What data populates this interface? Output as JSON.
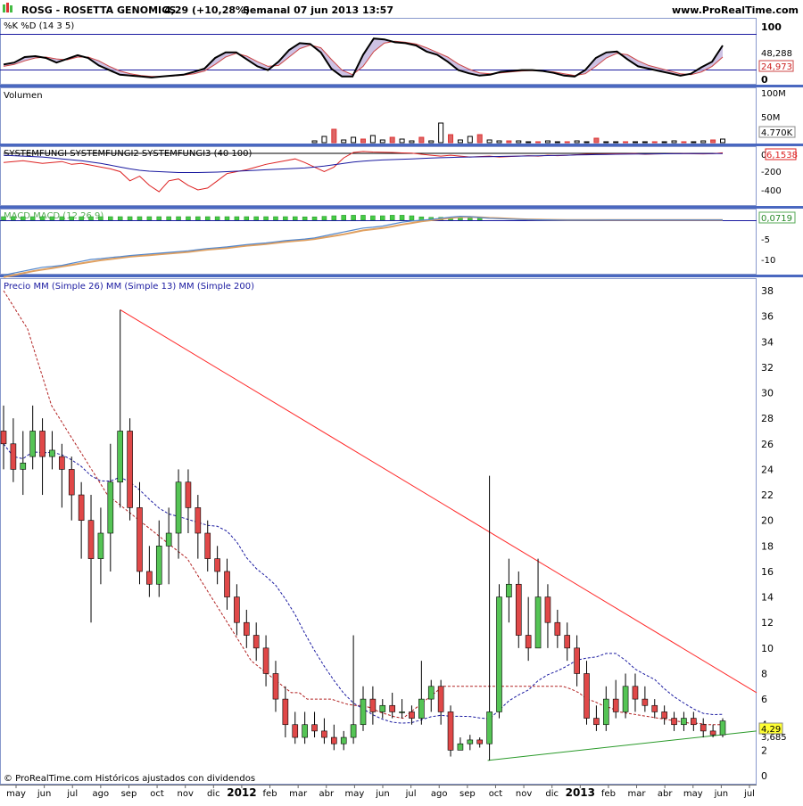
{
  "header": {
    "symbol_title": "ROSG - ROSETTA GENOMICS",
    "quote": "4,29 (+10,28%)",
    "period_date": "Semanal  07 jun 2013 13:57",
    "site": "www.ProRealTime.com"
  },
  "footer": {
    "copyright": "© ProRealTime.com  Históricos ajustados con dividendos"
  },
  "x_axis": {
    "labels": [
      "may",
      "jun",
      "jul",
      "ago",
      "sep",
      "oct",
      "nov",
      "dic",
      "2012",
      "feb",
      "mar",
      "abr",
      "may",
      "jun",
      "jul",
      "ago",
      "sep",
      "oct",
      "nov",
      "dic",
      "2013",
      "feb",
      "mar",
      "abr",
      "may",
      "jun",
      "jul"
    ],
    "bold_labels": [
      "2012",
      "2013"
    ]
  },
  "colors": {
    "up_candle": "#55c455",
    "down_candle": "#e04848",
    "ma26": "#b22222",
    "ma13": "#1a1aa0",
    "resistance_line": "#ff2a2a",
    "support_line": "#2a9a2a",
    "panel_sep": "#4a68c0",
    "stoch_k": "#000000",
    "stoch_d": "#cc4444",
    "vol_up": "#000000",
    "vol_down": "#dd3333",
    "sys1": "#000000",
    "sys2": "#dd2222",
    "sys3": "#1a1aa0",
    "macd_hist": "#44cc44",
    "macd_line": "#5588cc",
    "macd_signal": "#e0a060",
    "last_price_box": "#ffff33"
  },
  "chart_data": [
    {
      "type": "line",
      "panel": "stochastic",
      "title": "%K %D (14 3 5)",
      "ylim": [
        0,
        100
      ],
      "tick_labels": [
        "100",
        "0"
      ],
      "value_labels": [
        "48,288",
        "24,973"
      ],
      "series": [
        {
          "name": "%K",
          "values": [
            34,
            38,
            50,
            52,
            48,
            38,
            46,
            54,
            48,
            32,
            22,
            12,
            10,
            8,
            6,
            8,
            10,
            12,
            18,
            25,
            48,
            60,
            60,
            45,
            30,
            22,
            40,
            65,
            80,
            78,
            60,
            25,
            8,
            8,
            55,
            90,
            88,
            82,
            80,
            75,
            62,
            55,
            40,
            22,
            15,
            10,
            12,
            18,
            20,
            22,
            22,
            20,
            16,
            10,
            8,
            22,
            48,
            60,
            62,
            45,
            30,
            25,
            20,
            15,
            10,
            14,
            28,
            40,
            75
          ]
        },
        {
          "name": "%D",
          "values": [
            30,
            34,
            42,
            48,
            50,
            46,
            44,
            50,
            50,
            42,
            30,
            20,
            14,
            10,
            8,
            8,
            9,
            11,
            14,
            20,
            34,
            50,
            58,
            52,
            40,
            30,
            32,
            50,
            68,
            76,
            70,
            45,
            22,
            12,
            30,
            62,
            80,
            84,
            82,
            78,
            70,
            60,
            50,
            35,
            24,
            16,
            14,
            16,
            18,
            20,
            21,
            20,
            18,
            14,
            10,
            14,
            30,
            48,
            58,
            55,
            42,
            32,
            26,
            20,
            14,
            12,
            18,
            30,
            50
          ]
        }
      ]
    },
    {
      "type": "bar",
      "panel": "volume",
      "title": "Volumen",
      "tick_labels": [
        "100M",
        "50M"
      ],
      "value_labels": [
        "4.770K"
      ],
      "values": [
        0,
        0,
        0,
        0,
        0,
        0,
        0,
        0,
        0,
        0,
        0,
        0,
        0,
        0,
        0,
        0,
        0,
        0,
        0,
        0,
        0,
        0,
        0,
        0,
        0,
        0,
        0,
        0,
        0,
        0,
        0,
        0,
        2,
        7,
        15,
        3,
        6,
        4,
        8,
        3,
        6,
        4,
        2,
        6,
        2,
        22,
        9,
        3,
        7,
        9,
        3,
        2,
        2,
        2,
        1,
        1,
        2,
        1,
        1,
        2,
        1,
        5,
        1,
        1,
        1,
        1,
        1,
        1,
        1,
        2,
        1,
        1,
        2,
        3,
        4
      ]
    },
    {
      "type": "line",
      "panel": "systemfungi",
      "title": "SYSTEMFUNGI SYSTEMFUNGI2 SYSTEMFUNGI3 (40 100)",
      "tick_labels": [
        "0",
        "-200",
        "-400"
      ],
      "value_labels": [
        "6,1538"
      ],
      "series": [
        {
          "name": "SYSTEMFUNGI",
          "values": [
            0,
            0,
            0,
            0,
            0,
            0,
            0,
            0,
            0,
            0,
            0,
            0,
            0,
            0,
            0,
            0,
            0,
            0,
            0,
            0,
            0,
            0,
            0,
            0,
            0,
            0,
            0,
            0,
            0,
            0,
            0,
            0,
            0,
            0,
            0,
            0,
            0,
            0,
            0,
            0,
            0,
            0,
            0,
            0,
            0,
            0,
            0,
            0,
            0,
            0,
            0,
            0,
            0,
            0,
            0,
            0,
            0,
            0,
            0,
            0,
            0,
            0,
            0,
            0,
            0,
            0,
            0,
            0,
            0,
            0,
            0,
            0,
            0,
            0,
            0
          ]
        },
        {
          "name": "SYSTEMFUNGI2",
          "values": [
            -100,
            -90,
            -80,
            -95,
            -110,
            -100,
            -90,
            -120,
            -110,
            -130,
            -150,
            -170,
            -200,
            -300,
            -250,
            -350,
            -420,
            -300,
            -280,
            -350,
            -400,
            -380,
            -300,
            -220,
            -200,
            -180,
            -150,
            -120,
            -100,
            -80,
            -60,
            -100,
            -150,
            -200,
            -150,
            -50,
            10,
            20,
            15,
            12,
            10,
            5,
            2,
            -10,
            -20,
            -30,
            -20,
            -30,
            -40,
            -35,
            -30,
            -40,
            -35,
            -30,
            -25,
            -30,
            -20,
            -25,
            -20,
            -15,
            -10,
            -10,
            -8,
            -5,
            -5,
            -3,
            -10,
            -6,
            -5,
            -4,
            -3,
            -5,
            -6,
            -4,
            6
          ]
        },
        {
          "name": "SYSTEMFUNGI3",
          "values": [
            -20,
            -25,
            -30,
            -35,
            -40,
            -50,
            -60,
            -70,
            -80,
            -95,
            -110,
            -130,
            -150,
            -170,
            -185,
            -195,
            -200,
            -205,
            -210,
            -210,
            -210,
            -208,
            -205,
            -200,
            -195,
            -190,
            -185,
            -180,
            -175,
            -170,
            -165,
            -160,
            -150,
            -140,
            -125,
            -110,
            -95,
            -85,
            -78,
            -72,
            -68,
            -64,
            -60,
            -56,
            -52,
            -48,
            -45,
            -42,
            -40,
            -38,
            -36,
            -34,
            -32,
            -30,
            -28,
            -26,
            -24,
            -22,
            -20,
            -18,
            -16,
            -14,
            -12,
            -10,
            -9,
            -8,
            -7,
            -6,
            -5,
            -4,
            -3,
            -3,
            -2,
            -2,
            -2
          ]
        }
      ]
    },
    {
      "type": "line",
      "panel": "macd",
      "title": "MACD MACD (12 26 9)",
      "tick_labels": [
        "0",
        "-5",
        "-10"
      ],
      "value_labels": [
        "0,0719"
      ],
      "series": [
        {
          "name": "MACD",
          "values": [
            -14,
            -13.5,
            -13,
            -12.5,
            -12,
            -11.8,
            -11.5,
            -11,
            -10.5,
            -10,
            -9.8,
            -9.5,
            -9.3,
            -9,
            -8.8,
            -8.6,
            -8.4,
            -8.2,
            -8,
            -7.8,
            -7.5,
            -7.2,
            -7,
            -6.8,
            -6.5,
            -6.2,
            -6,
            -5.8,
            -5.5,
            -5.2,
            -5,
            -4.8,
            -4.5,
            -4,
            -3.5,
            -3,
            -2.5,
            -2,
            -1.8,
            -1.5,
            -1,
            -0.5,
            -0.2,
            0,
            0.2,
            0.5,
            0.8,
            1,
            0.9,
            0.7,
            0.5,
            0.4,
            0.3,
            0.2,
            0.15,
            0.1,
            0.1,
            0.05,
            0.05,
            0.05,
            0.05,
            0.05,
            0.06,
            0.06,
            0.06,
            0.06,
            0.06,
            0.07,
            0.07,
            0.07,
            0.07,
            0.07,
            0.07,
            0.07,
            0.07
          ]
        },
        {
          "name": "Signal",
          "values": [
            -14.5,
            -14,
            -13.5,
            -13,
            -12.6,
            -12.2,
            -11.8,
            -11.4,
            -11,
            -10.6,
            -10.2,
            -9.9,
            -9.6,
            -9.3,
            -9.1,
            -8.9,
            -8.7,
            -8.5,
            -8.3,
            -8.1,
            -7.8,
            -7.5,
            -7.3,
            -7.1,
            -6.8,
            -6.5,
            -6.3,
            -6.1,
            -5.8,
            -5.5,
            -5.3,
            -5.1,
            -4.8,
            -4.4,
            -4,
            -3.6,
            -3.1,
            -2.6,
            -2.3,
            -2,
            -1.6,
            -1.1,
            -0.7,
            -0.3,
            0,
            0.3,
            0.6,
            0.8,
            0.85,
            0.75,
            0.6,
            0.5,
            0.4,
            0.3,
            0.2,
            0.15,
            0.12,
            0.08,
            0.06,
            0.05,
            0.05,
            0.05,
            0.05,
            0.05,
            0.06,
            0.06,
            0.06,
            0.06,
            0.07,
            0.07,
            0.07,
            0.07,
            0.07,
            0.07,
            0.07
          ]
        }
      ]
    },
    {
      "type": "line",
      "panel": "price",
      "title": "Precio MM (Simple 26) MM (Simple 13) MM (Simple 200)",
      "ylim": [
        0,
        38
      ],
      "tick_labels": [
        "38",
        "36",
        "34",
        "32",
        "30",
        "28",
        "26",
        "24",
        "22",
        "20",
        "18",
        "16",
        "14",
        "12",
        "10",
        "8",
        "6",
        "4",
        "2",
        "0"
      ],
      "value_labels": [
        "4,29",
        "3,685"
      ],
      "candles": [
        [
          27,
          26,
          29,
          24
        ],
        [
          26,
          24,
          28,
          23
        ],
        [
          24,
          24.5,
          27,
          22
        ],
        [
          25,
          27,
          29,
          24
        ],
        [
          27,
          25,
          28,
          22
        ],
        [
          25,
          25.5,
          27,
          24
        ],
        [
          25,
          24,
          26,
          21
        ],
        [
          24,
          22,
          25,
          20
        ],
        [
          22,
          20,
          23,
          17
        ],
        [
          20,
          17,
          22,
          12
        ],
        [
          17,
          19,
          21,
          15
        ],
        [
          19,
          23,
          26,
          16
        ],
        [
          23,
          27,
          36.5,
          21
        ],
        [
          27,
          21,
          28,
          20
        ],
        [
          21,
          16,
          23,
          15
        ],
        [
          16,
          15,
          18,
          14
        ],
        [
          15,
          18,
          20,
          14
        ],
        [
          18,
          19,
          21,
          15
        ],
        [
          19,
          23,
          24,
          17
        ],
        [
          23,
          21,
          24,
          19
        ],
        [
          21,
          19,
          22,
          17
        ],
        [
          19,
          17,
          20,
          16
        ],
        [
          17,
          16,
          18,
          15
        ],
        [
          16,
          14,
          17,
          13
        ],
        [
          14,
          12,
          15,
          11
        ],
        [
          12,
          11,
          13,
          10
        ],
        [
          11,
          10,
          12,
          9
        ],
        [
          10,
          8,
          11,
          7
        ],
        [
          8,
          6,
          9,
          5
        ],
        [
          6,
          4,
          7,
          3
        ],
        [
          4,
          3,
          5,
          2.5
        ],
        [
          3,
          4,
          5,
          2.5
        ],
        [
          4,
          3.5,
          5,
          3
        ],
        [
          3.5,
          3,
          4.5,
          2.5
        ],
        [
          3,
          2.5,
          4,
          2
        ],
        [
          2.5,
          3,
          3.5,
          2
        ],
        [
          3,
          4,
          11,
          2.5
        ],
        [
          4,
          6,
          7,
          3.5
        ],
        [
          6,
          5,
          7,
          4
        ],
        [
          5,
          5.5,
          6,
          4.5
        ],
        [
          5.5,
          5,
          6.5,
          4.5
        ],
        [
          5,
          5,
          6,
          4.5
        ],
        [
          5,
          4.5,
          5.5,
          4
        ],
        [
          4.5,
          6,
          9,
          4
        ],
        [
          6,
          7,
          7.5,
          5
        ],
        [
          7,
          5,
          7.5,
          4
        ],
        [
          5,
          2,
          5.5,
          1.5
        ],
        [
          2,
          2.5,
          3,
          2
        ],
        [
          2.5,
          2.8,
          3.2,
          2
        ],
        [
          2.8,
          2.5,
          3,
          2.2
        ],
        [
          2.5,
          5,
          23.5,
          1.2
        ],
        [
          5,
          14,
          15,
          4.5
        ],
        [
          14,
          15,
          17,
          12
        ],
        [
          15,
          11,
          16,
          10
        ],
        [
          11,
          10,
          14,
          9
        ],
        [
          10,
          14,
          17,
          11
        ],
        [
          14,
          12,
          15,
          10
        ],
        [
          12,
          11,
          13,
          10
        ],
        [
          11,
          10,
          12,
          9
        ],
        [
          10,
          8,
          11,
          7
        ],
        [
          8,
          4.5,
          9,
          4
        ],
        [
          4.5,
          4,
          5.5,
          3.5
        ],
        [
          4,
          6,
          7,
          3.5
        ],
        [
          6,
          5,
          7.5,
          4.5
        ],
        [
          5,
          7,
          8,
          4.5
        ],
        [
          7,
          6,
          8,
          5
        ],
        [
          6,
          5.5,
          7,
          5
        ],
        [
          5.5,
          5,
          6,
          4.5
        ],
        [
          5,
          4.5,
          5.5,
          4
        ],
        [
          4.5,
          4,
          5,
          3.5
        ],
        [
          4,
          4.5,
          5,
          3.5
        ],
        [
          4.5,
          4,
          5,
          3.5
        ],
        [
          4,
          3.5,
          4.5,
          3
        ],
        [
          3.5,
          3.2,
          4,
          3
        ],
        [
          3.2,
          4.29,
          4.5,
          3
        ]
      ],
      "ma26": [
        38,
        37,
        36,
        35,
        33,
        31,
        29,
        28,
        27,
        26,
        25,
        24,
        23,
        22,
        21.5,
        21,
        20.5,
        20,
        19.5,
        19,
        18.5,
        18,
        17.5,
        17,
        16,
        15,
        14,
        13,
        12,
        11,
        10,
        9,
        8.5,
        8,
        7.5,
        7,
        6.5,
        6.5,
        6,
        6,
        6,
        6,
        5.8,
        5.6,
        5.5,
        5.5,
        5.3,
        5,
        4.8,
        4.6,
        4.5,
        5,
        5.5,
        6,
        6.5,
        7,
        7,
        7,
        7,
        7,
        7,
        7,
        7,
        7,
        7,
        7,
        7,
        7,
        7,
        7,
        7,
        6.8,
        6.5,
        6,
        5.8,
        5.5,
        5.3,
        5,
        4.9,
        4.8,
        4.7,
        4.6,
        4.5,
        4.4,
        4.3,
        4.2,
        4.1,
        4.1,
        4,
        4,
        4
      ]
    }
  ]
}
